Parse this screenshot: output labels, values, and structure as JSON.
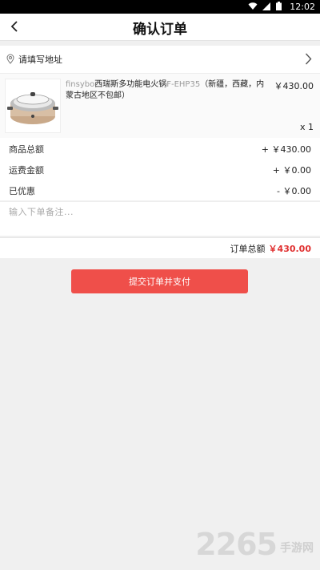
{
  "status": {
    "time": "12:02"
  },
  "header": {
    "title": "确认订单"
  },
  "address": {
    "label": "请填写地址"
  },
  "product": {
    "brand": "finsybo",
    "name": "西瑞斯多功能电火锅",
    "model": "F-EHP35",
    "note": "（新疆，西藏，内蒙古地区不包邮）",
    "price": "￥430.00",
    "qty": "x 1"
  },
  "summary": {
    "goods_label": "商品总额",
    "goods_value": "+ ￥430.00",
    "shipping_label": "运费金额",
    "shipping_value": "+ ￥0.00",
    "discount_label": "已优惠",
    "discount_value": "- ￥0.00"
  },
  "remark": {
    "placeholder": "输入下单备注..."
  },
  "total": {
    "label": "订单总额",
    "amount": "￥430.00"
  },
  "submit": {
    "label": "提交订单并支付"
  },
  "watermark": {
    "digits": "2265",
    "text": "手游网"
  },
  "colors": {
    "accent": "#ef4f4a",
    "price_red": "#e03030"
  }
}
